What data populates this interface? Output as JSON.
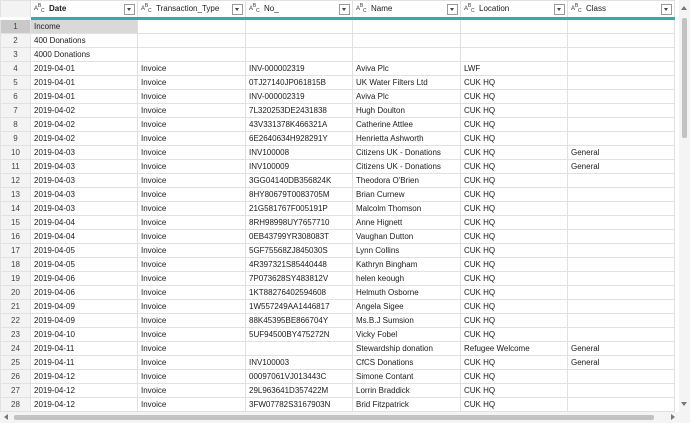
{
  "columns": [
    {
      "name": "Date",
      "type_icon": "ABC-123-type-icon"
    },
    {
      "name": "Transaction_Type",
      "type_icon": "ABC-type-icon"
    },
    {
      "name": "No_",
      "type_icon": "ABC-type-icon"
    },
    {
      "name": "Name",
      "type_icon": "ABC-type-icon"
    },
    {
      "name": "Location",
      "type_icon": "ABC-type-icon"
    },
    {
      "name": "Class",
      "type_icon": "ABC-type-icon"
    }
  ],
  "accent_color": "#2ab0a6",
  "rows": [
    {
      "n": "1",
      "cells": [
        "Income",
        "",
        "",
        "",
        "",
        ""
      ]
    },
    {
      "n": "2",
      "cells": [
        "400 Donations",
        "",
        "",
        "",
        "",
        ""
      ]
    },
    {
      "n": "3",
      "cells": [
        "4000 Donations",
        "",
        "",
        "",
        "",
        ""
      ]
    },
    {
      "n": "4",
      "cells": [
        "2019-04-01",
        "Invoice",
        "INV-000002319",
        "Aviva Plc",
        "LWF",
        ""
      ]
    },
    {
      "n": "5",
      "cells": [
        "2019-04-01",
        "Invoice",
        "0TJ27140JP061815B",
        "UK Water Filters Ltd",
        "CUK HQ",
        ""
      ]
    },
    {
      "n": "6",
      "cells": [
        "2019-04-01",
        "Invoice",
        "INV-000002319",
        "Aviva Plc",
        "CUK HQ",
        ""
      ]
    },
    {
      "n": "7",
      "cells": [
        "2019-04-02",
        "Invoice",
        "7L320253DE2431838",
        "Hugh Doulton",
        "CUK HQ",
        ""
      ]
    },
    {
      "n": "8",
      "cells": [
        "2019-04-02",
        "Invoice",
        "43V331378K466321A",
        "Catherine Attlee",
        "CUK HQ",
        ""
      ]
    },
    {
      "n": "9",
      "cells": [
        "2019-04-02",
        "Invoice",
        "6E2640634H928291Y",
        "Henrietta Ashworth",
        "CUK HQ",
        ""
      ]
    },
    {
      "n": "10",
      "cells": [
        "2019-04-03",
        "Invoice",
        "INV100008",
        "Citizens UK - Donations",
        "CUK HQ",
        "General"
      ]
    },
    {
      "n": "11",
      "cells": [
        "2019-04-03",
        "Invoice",
        "INV100009",
        "Citizens UK - Donations",
        "CUK HQ",
        "General"
      ]
    },
    {
      "n": "12",
      "cells": [
        "2019-04-03",
        "Invoice",
        "3GG04140DB356824K",
        "Theodora O'Brien",
        "CUK HQ",
        ""
      ]
    },
    {
      "n": "13",
      "cells": [
        "2019-04-03",
        "Invoice",
        "8HY80679T0083705M",
        "Brian Curnew",
        "CUK HQ",
        ""
      ]
    },
    {
      "n": "14",
      "cells": [
        "2019-04-03",
        "Invoice",
        "21G581767F005191P",
        "Malcolm Thomson",
        "CUK HQ",
        ""
      ]
    },
    {
      "n": "15",
      "cells": [
        "2019-04-04",
        "Invoice",
        "8RH98998UY7657710",
        "Anne Hignett",
        "CUK HQ",
        ""
      ]
    },
    {
      "n": "16",
      "cells": [
        "2019-04-04",
        "Invoice",
        "0EB43799YR308083T",
        "Vaughan Dutton",
        "CUK HQ",
        ""
      ]
    },
    {
      "n": "17",
      "cells": [
        "2019-04-05",
        "Invoice",
        "5GF75568ZJ845030S",
        "Lynn Collins",
        "CUK HQ",
        ""
      ]
    },
    {
      "n": "18",
      "cells": [
        "2019-04-05",
        "Invoice",
        "4R397321S85440448",
        "Kathryn Bingham",
        "CUK HQ",
        ""
      ]
    },
    {
      "n": "19",
      "cells": [
        "2019-04-06",
        "Invoice",
        "7P073628SY483812V",
        "helen keough",
        "CUK HQ",
        ""
      ]
    },
    {
      "n": "20",
      "cells": [
        "2019-04-06",
        "Invoice",
        "1KT88276402594608",
        "Helmuth Osborne",
        "CUK HQ",
        ""
      ]
    },
    {
      "n": "21",
      "cells": [
        "2019-04-09",
        "Invoice",
        "1W557249AA1446817",
        "Angela Sigee",
        "CUK HQ",
        ""
      ]
    },
    {
      "n": "22",
      "cells": [
        "2019-04-09",
        "Invoice",
        "88K45395BE866704Y",
        "Ms.B.J Sumsion",
        "CUK HQ",
        ""
      ]
    },
    {
      "n": "23",
      "cells": [
        "2019-04-10",
        "Invoice",
        "5UF94500BY475272N",
        "Vicky Fobel",
        "CUK HQ",
        ""
      ]
    },
    {
      "n": "24",
      "cells": [
        "2019-04-11",
        "Invoice",
        "",
        "Stewardship donation",
        "Refugee Welcome",
        "General"
      ]
    },
    {
      "n": "25",
      "cells": [
        "2019-04-11",
        "Invoice",
        "INV100003",
        "CfCS Donations",
        "CUK HQ",
        "General"
      ]
    },
    {
      "n": "26",
      "cells": [
        "2019-04-12",
        "Invoice",
        "00097061VJ013443C",
        "Simone Contant",
        "CUK HQ",
        ""
      ]
    },
    {
      "n": "27",
      "cells": [
        "2019-04-12",
        "Invoice",
        "29L963641D357422M",
        "Lorrin Braddick",
        "CUK HQ",
        ""
      ]
    },
    {
      "n": "28",
      "cells": [
        "2019-04-12",
        "Invoice",
        "3FW07782S3167903N",
        "Brid Fitzpatrick",
        "CUK HQ",
        ""
      ]
    }
  ]
}
